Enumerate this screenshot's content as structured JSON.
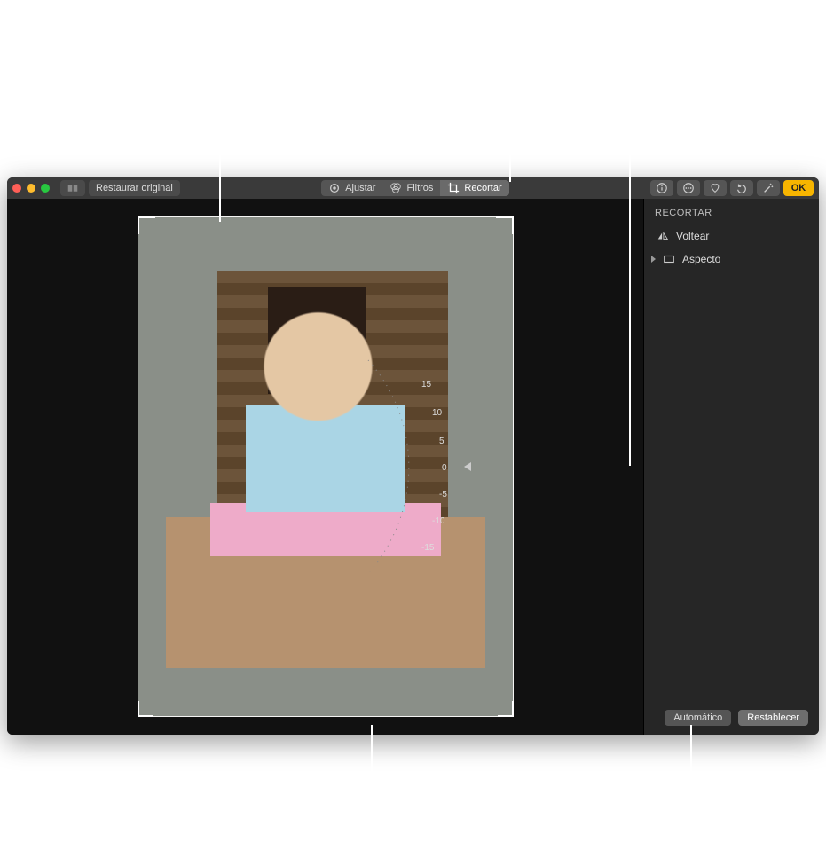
{
  "toolbar": {
    "restore_original": "Restaurar original",
    "adjust": "Ajustar",
    "filters": "Filtros",
    "crop": "Recortar",
    "ok": "OK"
  },
  "sidebar": {
    "title": "RECORTAR",
    "flip": "Voltear",
    "aspect": "Aspecto"
  },
  "footer": {
    "auto": "Automático",
    "reset": "Restablecer"
  },
  "dial": {
    "ticks": [
      "15",
      "10",
      "5",
      "0",
      "-5",
      "-10",
      "-15"
    ]
  }
}
